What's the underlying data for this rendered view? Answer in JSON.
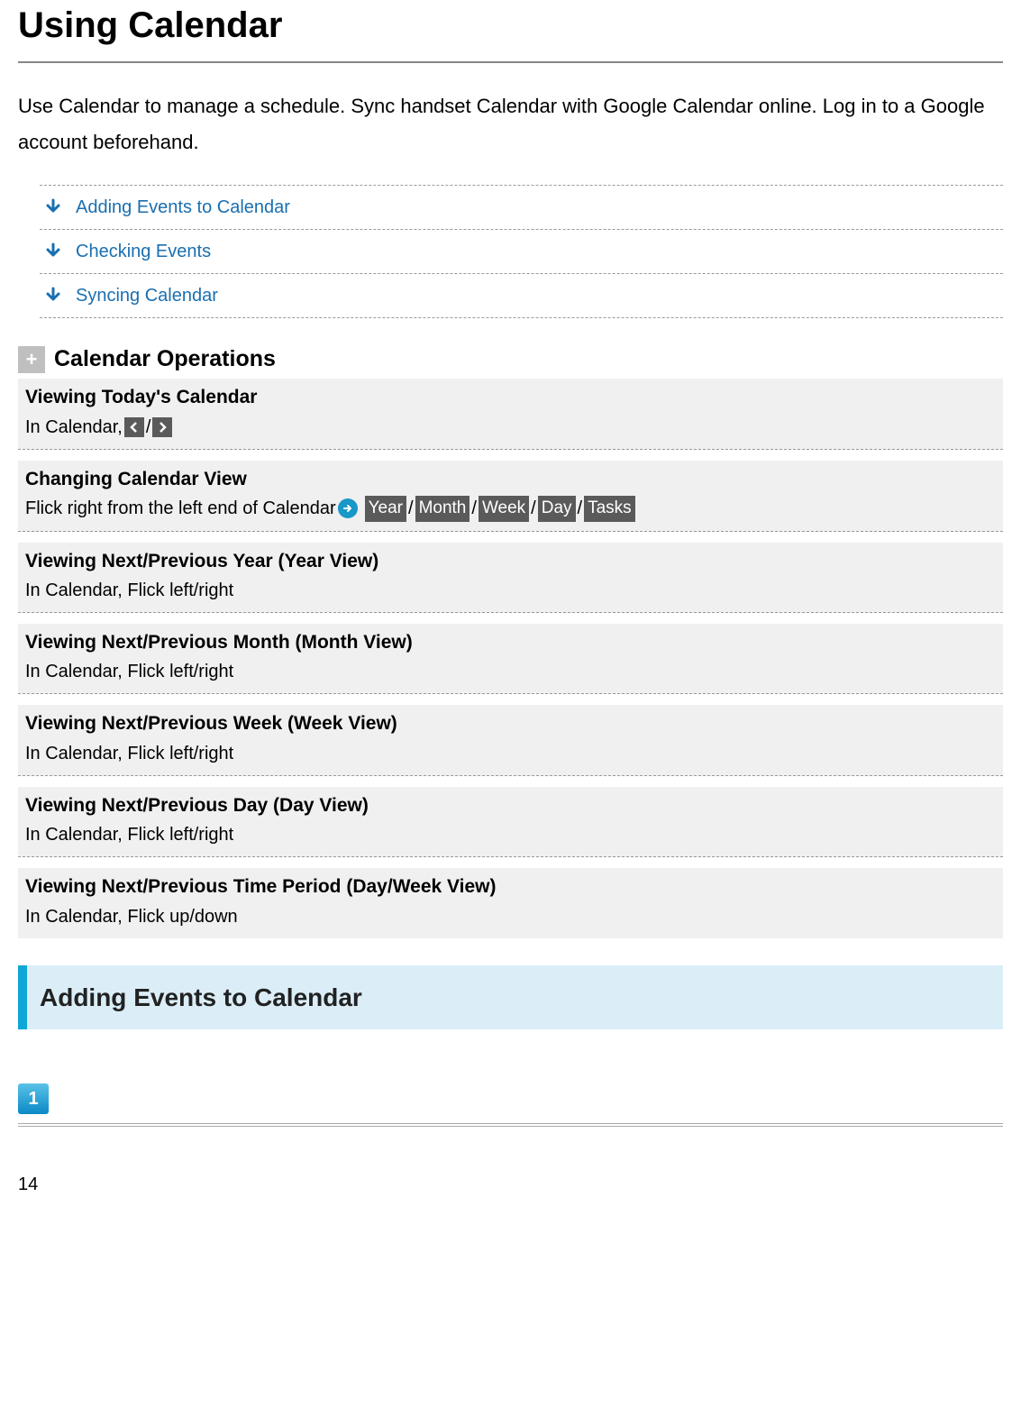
{
  "page": {
    "title": "Using Calendar",
    "intro": "Use Calendar to manage a schedule. Sync handset Calendar with Google Calendar online. Log in to a Google account beforehand.",
    "page_number": "14"
  },
  "toc": [
    {
      "label": "Adding Events to Calendar"
    },
    {
      "label": "Checking Events"
    },
    {
      "label": "Syncing Calendar"
    }
  ],
  "operations": {
    "heading": "Calendar Operations",
    "items": [
      {
        "title": "Viewing Today's Calendar",
        "prefix_text": "In Calendar, ",
        "icons_after_prefix": [
          "left",
          "right"
        ],
        "icons_separator": "/",
        "body_after": ""
      },
      {
        "title": "Changing Calendar View",
        "prefix_text": "Flick right from the left end of Calendar ",
        "icons_after_prefix": [
          "arrow-circle"
        ],
        "chips_after": [
          "Year",
          "Month",
          "Week",
          "Day",
          "Tasks"
        ],
        "chips_separator": "/"
      },
      {
        "title": "Viewing Next/Previous Year (Year View)",
        "body": "In Calendar, Flick left/right"
      },
      {
        "title": "Viewing Next/Previous Month (Month View)",
        "body": "In Calendar, Flick left/right"
      },
      {
        "title": "Viewing Next/Previous Week (Week View)",
        "body": "In Calendar, Flick left/right"
      },
      {
        "title": "Viewing Next/Previous Day (Day View)",
        "body": "In Calendar, Flick left/right"
      },
      {
        "title": "Viewing Next/Previous Time Period (Day/Week View)",
        "body": "In Calendar, Flick up/down"
      }
    ]
  },
  "section": {
    "title": "Adding Events to Calendar"
  },
  "step": {
    "number": "1"
  }
}
